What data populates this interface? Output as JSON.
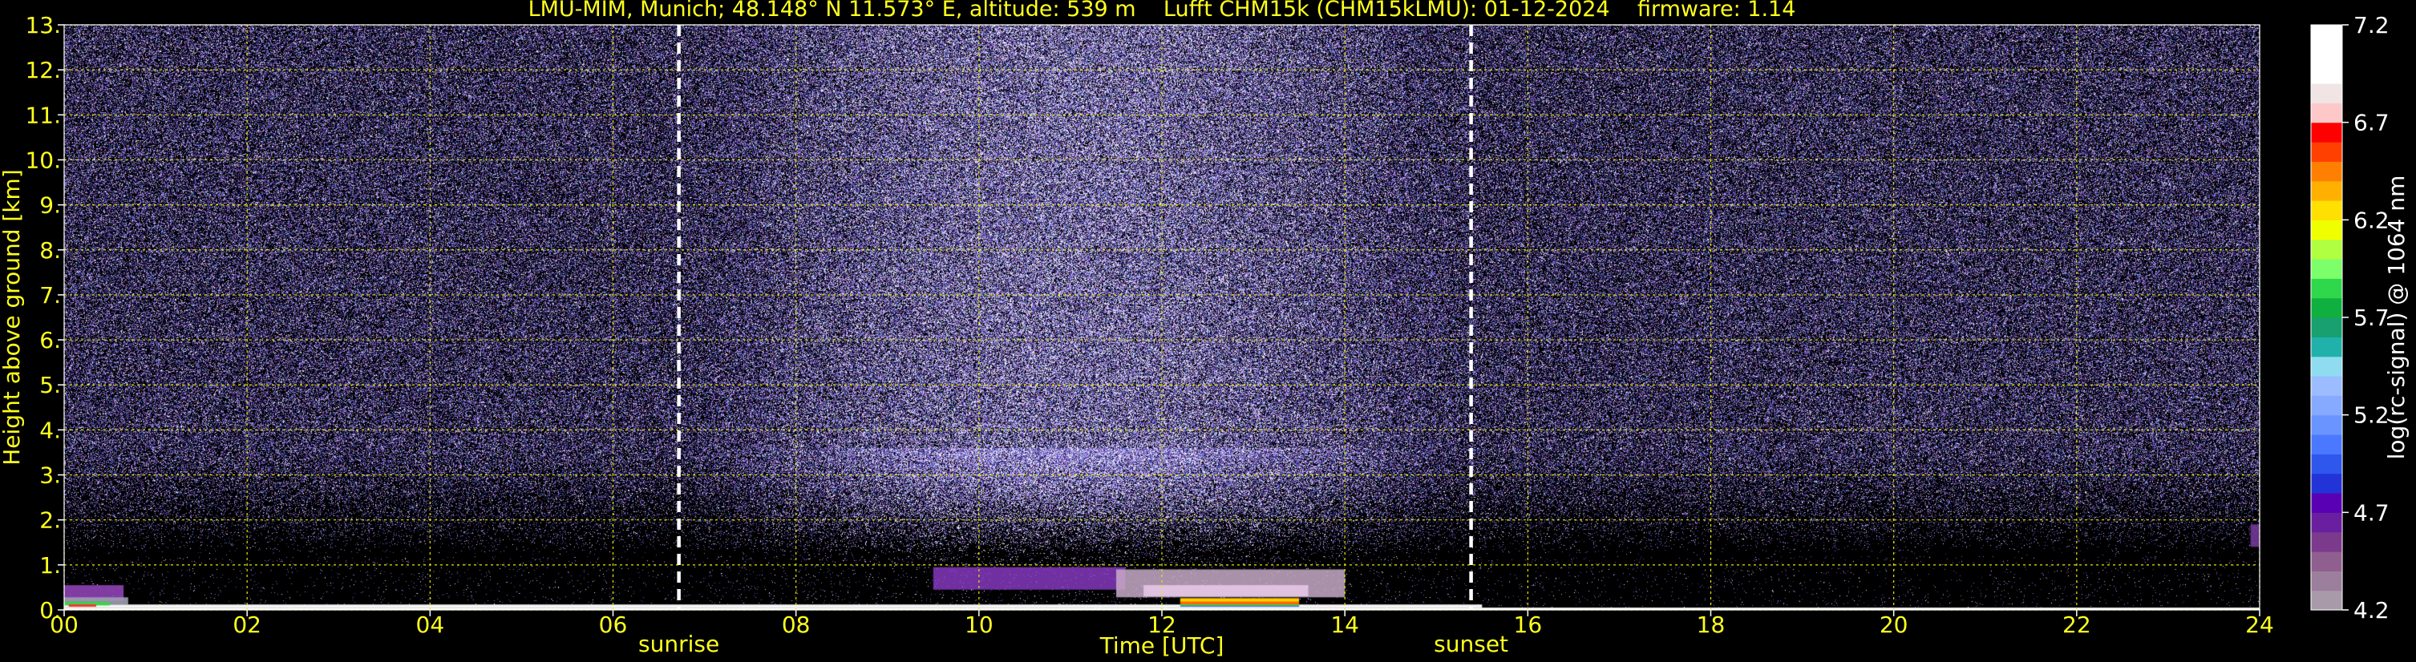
{
  "title": "LMU-MIM, Munich; 48.148° N 11.573° E, altitude: 539 m    Lufft CHM15k (CHM15kLMU): 01-12-2024    firmware: 1.14",
  "chart_data": {
    "type": "heatmap",
    "xlabel": "Time [UTC]",
    "ylabel": "Height above ground [km]",
    "xlim": [
      0,
      24
    ],
    "ylim": [
      0,
      13
    ],
    "x_ticks": [
      "00",
      "02",
      "04",
      "06",
      "08",
      "10",
      "12",
      "14",
      "16",
      "18",
      "20",
      "22",
      "24"
    ],
    "y_ticks": [
      "0.",
      "1.",
      "2.",
      "3.",
      "4.",
      "5.",
      "6.",
      "7.",
      "8.",
      "9.",
      "10.",
      "11.",
      "12.",
      "13."
    ],
    "grid": true,
    "grid_color": "#e6e600",
    "markers": [
      {
        "label": "sunrise",
        "x": 6.72
      },
      {
        "label": "sunset",
        "x": 15.38
      }
    ],
    "colorbar": {
      "label": "log(rc-signal) @ 1064 nm",
      "range": [
        4.2,
        7.2
      ],
      "ticks": [
        "4.2",
        "4.7",
        "5.2",
        "5.7",
        "6.2",
        "6.7",
        "7.2"
      ],
      "colors": [
        "#a99aa9",
        "#9c7f9c",
        "#8f5f8f",
        "#7c3a8c",
        "#6a1fa0",
        "#5a00b4",
        "#2233d8",
        "#2f57ee",
        "#4a78ff",
        "#6a94ff",
        "#86aaff",
        "#9bbcff",
        "#8fdcf0",
        "#20b2aa",
        "#18a070",
        "#10b040",
        "#2ed84a",
        "#7cff6a",
        "#b0ff40",
        "#f0ff00",
        "#ffe000",
        "#ffb000",
        "#ff8000",
        "#ff4000",
        "#ff0000",
        "#ffc8c8",
        "#f0e4e4",
        "#ffffff",
        "#ffffff",
        "#ffffff"
      ]
    }
  }
}
